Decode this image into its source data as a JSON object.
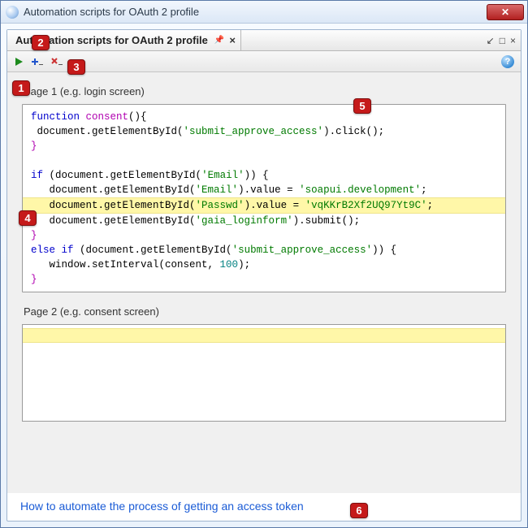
{
  "window": {
    "title": "Automation scripts for OAuth 2 profile"
  },
  "tab": {
    "title": "Automation scripts for OAuth 2 profile"
  },
  "toolbar": {
    "help_glyph": "?"
  },
  "pages": {
    "page1": {
      "label": "Page 1 (e.g. login screen)",
      "code": {
        "l1_kw": "function",
        "l1_name": " consent",
        "l1_rest": "(){",
        "l2": " document.getElementById(",
        "l2_str": "'submit_approve_access'",
        "l2_rest": ").click();",
        "l3": "}",
        "l4": "",
        "l5_kw": "if",
        "l5_a": " (document.getElementById(",
        "l5_str": "'Email'",
        "l5_b": ")) {",
        "l6_a": "   document.getElementById(",
        "l6_str": "'Email'",
        "l6_b": ").value = ",
        "l6_val": "'soapui.development'",
        "l6_c": ";",
        "l7_a": "   document.getElementById(",
        "l7_str": "'Passwd'",
        "l7_b": ").value = ",
        "l7_val": "'vqKKrB2Xf2UQ97Yt9C'",
        "l7_c": ";",
        "l8_a": "   document.getElementById(",
        "l8_str": "'gaia_loginform'",
        "l8_b": ").submit();",
        "l9": "}",
        "l10_kw": "else if",
        "l10_a": " (document.getElementById(",
        "l10_str": "'submit_approve_access'",
        "l10_b": ")) {",
        "l11_a": "   window.setInterval(consent, ",
        "l11_num": "100",
        "l11_b": ");",
        "l12": "}"
      }
    },
    "page2": {
      "label": "Page 2 (e.g. consent screen)"
    }
  },
  "footer": {
    "link_text": "How to automate the process of getting an access token"
  },
  "callouts": {
    "c1": "1",
    "c2": "2",
    "c3": "3",
    "c4": "4",
    "c5": "5",
    "c6": "6"
  }
}
